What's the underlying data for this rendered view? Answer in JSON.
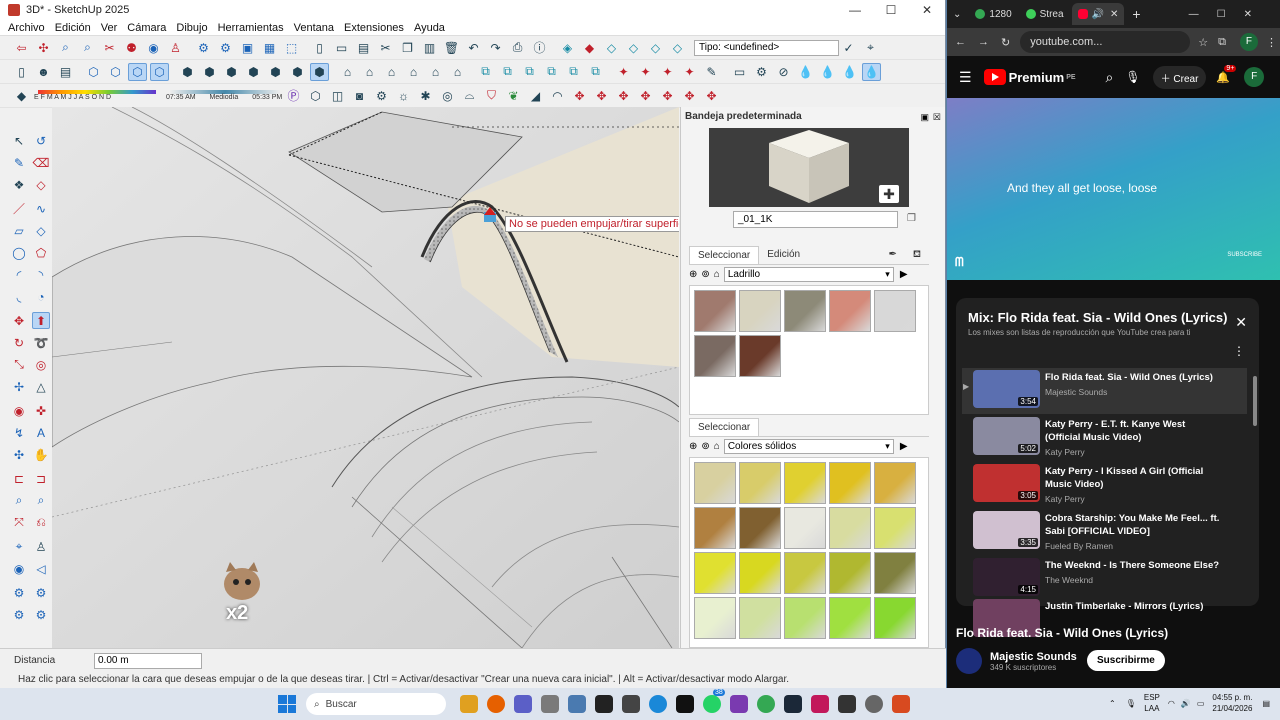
{
  "sketchup": {
    "title": "3D* - SketchUp 2025",
    "window_controls": [
      "—",
      "☐",
      "✕"
    ],
    "menu": [
      "Archivo",
      "Edición",
      "Ver",
      "Cámara",
      "Dibujo",
      "Herramientas",
      "Ventana",
      "Extensiones",
      "Ayuda"
    ],
    "tipo_field": "Tipo: <undefined>",
    "sun": {
      "months": "E F M A M J J A S O N D",
      "time_start": "07:35 AM",
      "midday": "Mediodía",
      "time_end": "05:33 PM"
    },
    "tooltip": "No se pueden empujar/tirar superficies curvas o alisadas.",
    "badge": "x2",
    "tray": {
      "title": "Bandeja predeterminada",
      "material_name": "_01_1K",
      "tabs1": [
        "Seleccionar",
        "Edición"
      ],
      "library1": "Ladrillo",
      "tabs2": [
        "Seleccionar"
      ],
      "library2": "Colores sólidos",
      "brick_swatches": [
        "#a07a6e",
        "#d8d4c0",
        "#8d8a78",
        "#d48a7a",
        "#d8d8d8",
        "#7a6a62",
        "#6a3a2a"
      ],
      "color_swatches": [
        "#d8d0a0",
        "#d8cc6a",
        "#e0d030",
        "#e0c020",
        "#d8b040",
        "#b08040",
        "#806030",
        "#e8e8e0",
        "#d8dca0",
        "#d8e070",
        "#e0e030",
        "#d8d820",
        "#c8c840",
        "#b0b830",
        "#808040",
        "#e8f0d0",
        "#d0e0a0",
        "#b8e070",
        "#a0e040",
        "#88d830"
      ]
    },
    "status": {
      "distance_label": "Distancia",
      "distance_value": "0.00 m",
      "hint": "Haz clic para seleccionar la cara que deseas empujar o de la que deseas tirar. | Ctrl = Activar/desactivar \"Crear una nueva cara inicial\". | Alt = Activar/desactivar modo Alargar."
    }
  },
  "chrome": {
    "tabs": [
      {
        "label": "1280",
        "color": "#34a853"
      },
      {
        "label": "Strea",
        "color": "#3ecf5a"
      },
      {
        "label": "",
        "color": "#ff0033"
      }
    ],
    "new_tab": "+",
    "url": "youtube.com...",
    "profile": "F",
    "youtube": {
      "brand": "Premium",
      "region": "PE",
      "create": "Crear",
      "notifications": "9+",
      "lyric": "And they all get loose, loose",
      "subscribe_wm": "SUBSCRIBE",
      "playlist": {
        "title": "Mix: Flo Rida feat. Sia - Wild Ones (Lyrics)",
        "description": "Los mixes son listas de reproducción que YouTube crea para ti",
        "items": [
          {
            "title": "Flo Rida feat. Sia - Wild Ones (Lyrics)",
            "channel": "Majestic Sounds",
            "duration": "3:54",
            "color": "#5b6fb0"
          },
          {
            "title": "Katy Perry - E.T. ft. Kanye West (Official Music Video)",
            "channel": "Katy Perry",
            "duration": "5:02",
            "color": "#8a8aa0"
          },
          {
            "title": "Katy Perry - I Kissed A Girl (Official Music Video)",
            "channel": "Katy Perry",
            "duration": "3:05",
            "color": "#c03030"
          },
          {
            "title": "Cobra Starship: You Make Me Feel... ft. Sabi [OFFICIAL VIDEO]",
            "channel": "Fueled By Ramen",
            "duration": "3:35",
            "color": "#d0c0d0"
          },
          {
            "title": "The Weeknd - Is There Someone Else?",
            "channel": "The Weeknd",
            "duration": "4:15",
            "color": "#302030"
          },
          {
            "title": "Justin Timberlake - Mirrors (Lyrics)",
            "channel": "",
            "duration": "",
            "color": "#704060"
          }
        ]
      },
      "video_title": "Flo Rida feat. Sia - Wild Ones (Lyrics)",
      "channel_name": "Majestic Sounds",
      "subscribers": "349 K suscriptores",
      "subscribe_button": "Suscribirme"
    }
  },
  "taskbar": {
    "search": "Buscar",
    "lang": "ESP",
    "lang2": "LAA",
    "time": "04:55 p. m.",
    "date": "21/04/2026",
    "chat_badge": "38"
  }
}
